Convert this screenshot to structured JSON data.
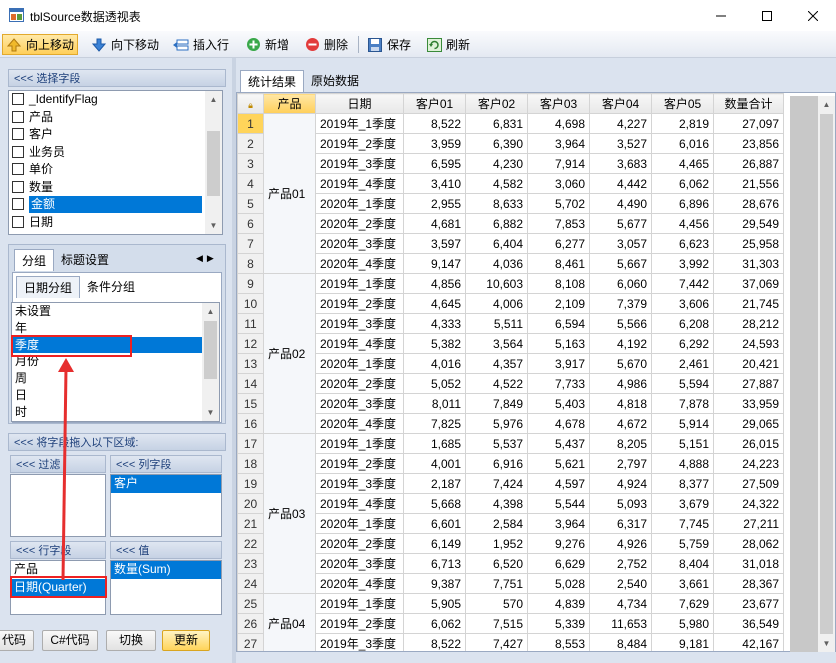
{
  "window": {
    "title": "tblSource数据透视表"
  },
  "toolbar": {
    "move_up": "向上移动",
    "move_down": "向下移动",
    "insert_row": "插入行",
    "add": "新增",
    "delete": "删除",
    "save": "保存",
    "refresh": "刷新"
  },
  "field_panel": {
    "header": "<<< 选择字段",
    "fields": [
      "_IdentifyFlag",
      "产品",
      "客户",
      "业务员",
      "单价",
      "数量",
      "金额",
      "日期"
    ],
    "selected_index": 6
  },
  "group_panel": {
    "tabs": [
      "分组",
      "标题设置"
    ],
    "subtabs": [
      "日期分组",
      "条件分组"
    ],
    "options": [
      "未设置",
      "年",
      "季度",
      "月份",
      "周",
      "日",
      "时"
    ],
    "selected_index": 2
  },
  "area_panel": {
    "header": "<<< 将字段拖入以下区域:",
    "filter_header": "<<< 过滤",
    "column_header": "<<< 列字段",
    "column_items": [
      "客户"
    ],
    "row_header": "<<< 行字段",
    "row_items": [
      "产品",
      "日期(Quarter)"
    ],
    "value_header": "<<< 值",
    "value_items": [
      "数量(Sum)"
    ]
  },
  "bottom_buttons": {
    "code": "代码",
    "csharp": "C#代码",
    "switch": "切换",
    "update": "更新"
  },
  "tabs": {
    "result": "统计结果",
    "raw": "原始数据"
  },
  "grid": {
    "headers": [
      "产品",
      "日期",
      "客户01",
      "客户02",
      "客户03",
      "客户04",
      "客户05",
      "数量合计"
    ],
    "groups": [
      {
        "name": "产品01",
        "rows": [
          [
            "2019年_1季度",
            "8,522",
            "6,831",
            "4,698",
            "4,227",
            "2,819",
            "27,097"
          ],
          [
            "2019年_2季度",
            "3,959",
            "6,390",
            "3,964",
            "3,527",
            "6,016",
            "23,856"
          ],
          [
            "2019年_3季度",
            "6,595",
            "4,230",
            "7,914",
            "3,683",
            "4,465",
            "26,887"
          ],
          [
            "2019年_4季度",
            "3,410",
            "4,582",
            "3,060",
            "4,442",
            "6,062",
            "21,556"
          ],
          [
            "2020年_1季度",
            "2,955",
            "8,633",
            "5,702",
            "4,490",
            "6,896",
            "28,676"
          ],
          [
            "2020年_2季度",
            "4,681",
            "6,882",
            "7,853",
            "5,677",
            "4,456",
            "29,549"
          ],
          [
            "2020年_3季度",
            "3,597",
            "6,404",
            "6,277",
            "3,057",
            "6,623",
            "25,958"
          ],
          [
            "2020年_4季度",
            "9,147",
            "4,036",
            "8,461",
            "5,667",
            "3,992",
            "31,303"
          ]
        ]
      },
      {
        "name": "产品02",
        "rows": [
          [
            "2019年_1季度",
            "4,856",
            "10,603",
            "8,108",
            "6,060",
            "7,442",
            "37,069"
          ],
          [
            "2019年_2季度",
            "4,645",
            "4,006",
            "2,109",
            "7,379",
            "3,606",
            "21,745"
          ],
          [
            "2019年_3季度",
            "4,333",
            "5,511",
            "6,594",
            "5,566",
            "6,208",
            "28,212"
          ],
          [
            "2019年_4季度",
            "5,382",
            "3,564",
            "5,163",
            "4,192",
            "6,292",
            "24,593"
          ],
          [
            "2020年_1季度",
            "4,016",
            "4,357",
            "3,917",
            "5,670",
            "2,461",
            "20,421"
          ],
          [
            "2020年_2季度",
            "5,052",
            "4,522",
            "7,733",
            "4,986",
            "5,594",
            "27,887"
          ],
          [
            "2020年_3季度",
            "8,011",
            "7,849",
            "5,403",
            "4,818",
            "7,878",
            "33,959"
          ],
          [
            "2020年_4季度",
            "7,825",
            "5,976",
            "4,678",
            "4,672",
            "5,914",
            "29,065"
          ]
        ]
      },
      {
        "name": "产品03",
        "rows": [
          [
            "2019年_1季度",
            "1,685",
            "5,537",
            "5,437",
            "8,205",
            "5,151",
            "26,015"
          ],
          [
            "2019年_2季度",
            "4,001",
            "6,916",
            "5,621",
            "2,797",
            "4,888",
            "24,223"
          ],
          [
            "2019年_3季度",
            "2,187",
            "7,424",
            "4,597",
            "4,924",
            "8,377",
            "27,509"
          ],
          [
            "2019年_4季度",
            "5,668",
            "4,398",
            "5,544",
            "5,093",
            "3,679",
            "24,322"
          ],
          [
            "2020年_1季度",
            "6,601",
            "2,584",
            "3,964",
            "6,317",
            "7,745",
            "27,211"
          ],
          [
            "2020年_2季度",
            "6,149",
            "1,952",
            "9,276",
            "4,926",
            "5,759",
            "28,062"
          ],
          [
            "2020年_3季度",
            "6,713",
            "6,520",
            "6,629",
            "2,752",
            "8,404",
            "31,018"
          ],
          [
            "2020年_4季度",
            "9,387",
            "7,751",
            "5,028",
            "2,540",
            "3,661",
            "28,367"
          ]
        ]
      },
      {
        "name": "产品04",
        "rows": [
          [
            "2019年_1季度",
            "5,905",
            "570",
            "4,839",
            "4,734",
            "7,629",
            "23,677"
          ],
          [
            "2019年_2季度",
            "6,062",
            "7,515",
            "5,339",
            "11,653",
            "5,980",
            "36,549"
          ],
          [
            "2019年_3季度",
            "8,522",
            "7,427",
            "8,553",
            "8,484",
            "9,181",
            "42,167"
          ]
        ]
      }
    ]
  }
}
